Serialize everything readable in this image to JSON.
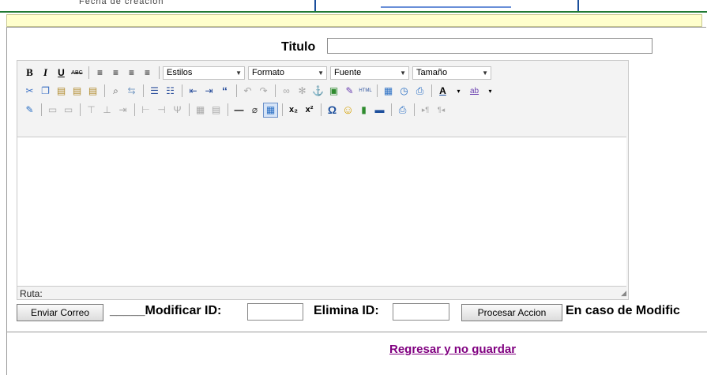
{
  "header": {
    "cut_text": "Fecha de creacion"
  },
  "form": {
    "titulo_label": "Titulo",
    "titulo_value": ""
  },
  "editor": {
    "combos": {
      "estilos": "Estilos",
      "formato": "Formato",
      "fuente": "Fuente",
      "tamano": "Tamaño"
    },
    "path_label": "Ruta:"
  },
  "actions": {
    "enviar_label": "Enviar Correo",
    "modificar_label": "_____Modificar ID:",
    "modificar_value": "",
    "elimina_label": "Elimina ID:",
    "elimina_value": "",
    "procesar_label": "Procesar Accion",
    "note": "En caso de Modific"
  },
  "footer": {
    "back_link": "Regresar y no guardar"
  },
  "colors": {
    "link": "#800080",
    "topbar_border": "#1f7a33",
    "highlight": "#ffffcc"
  }
}
